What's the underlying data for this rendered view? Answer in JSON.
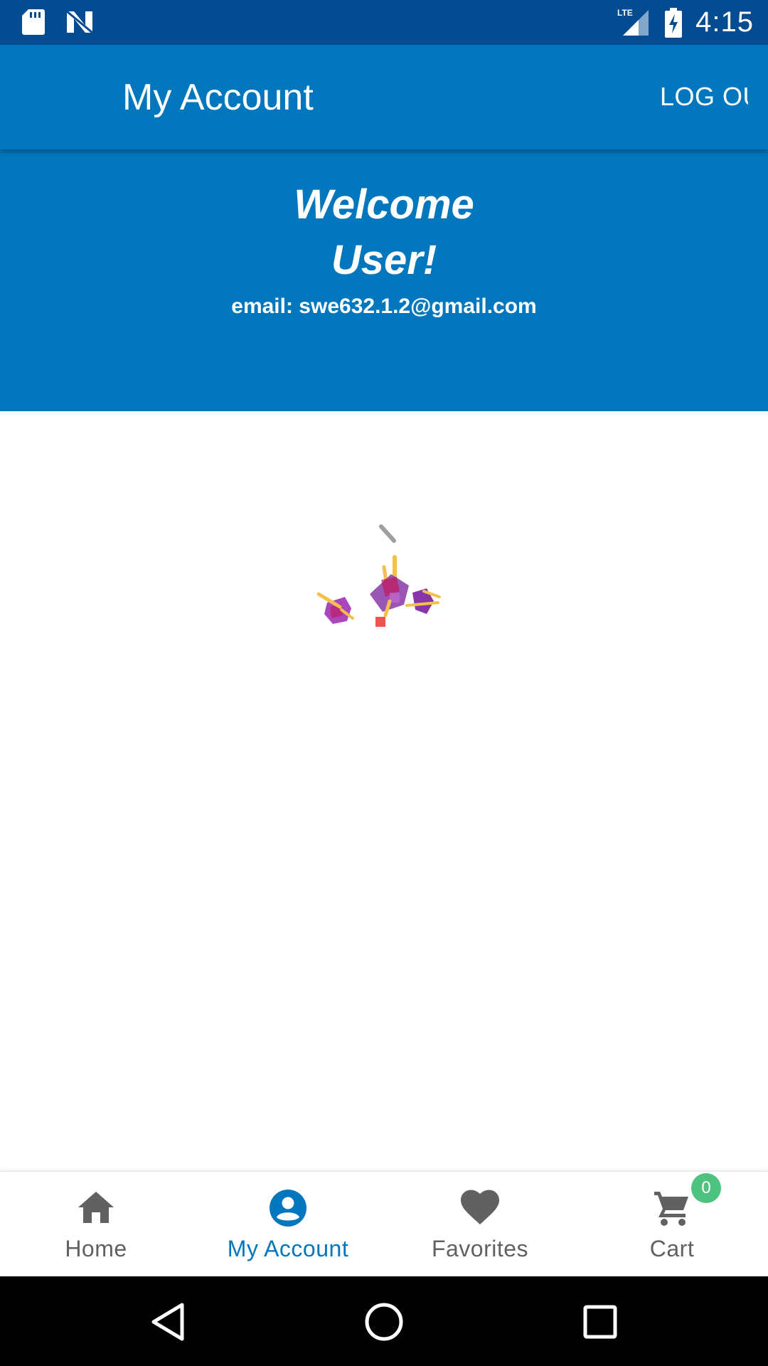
{
  "status_bar": {
    "time": "4:15",
    "network_label": "LTE",
    "icons": [
      "sd-card-icon",
      "notification-n-icon",
      "lte-signal-icon",
      "battery-charging-icon"
    ]
  },
  "app_bar": {
    "title": "My Account",
    "logout_label": "LOG OUT"
  },
  "welcome": {
    "line1": "Welcome",
    "line2": "User!",
    "email": "email: swe632.1.2@gmail.com"
  },
  "loader": {
    "icon": "confetti-loading-icon"
  },
  "bottom_nav": {
    "items": [
      {
        "label": "Home",
        "icon": "home-icon",
        "active": false
      },
      {
        "label": "My Account",
        "icon": "account-circle-icon",
        "active": true
      },
      {
        "label": "Favorites",
        "icon": "heart-icon",
        "active": false
      },
      {
        "label": "Cart",
        "icon": "cart-icon",
        "active": false
      }
    ],
    "cart_badge": "0"
  },
  "system_nav": {
    "buttons": [
      "back-icon",
      "home-circle-icon",
      "recents-icon"
    ]
  },
  "colors": {
    "primary": "#0277bd",
    "status_bar": "#034c92",
    "badge": "#4ec37f",
    "inactive": "#616161"
  }
}
